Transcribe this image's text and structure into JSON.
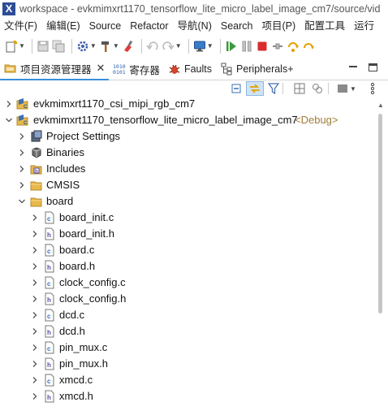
{
  "window": {
    "title": "workspace - evkmimxrt1170_tensorflow_lite_micro_label_image_cm7/source/vid"
  },
  "menu": {
    "items": [
      {
        "label": "文件(F)"
      },
      {
        "label": "编辑(E)"
      },
      {
        "label": "Source"
      },
      {
        "label": "Refactor"
      },
      {
        "label": "导航(N)"
      },
      {
        "label": "Search"
      },
      {
        "label": "项目(P)"
      },
      {
        "label": "配置工具"
      },
      {
        "label": "运行"
      }
    ]
  },
  "tabs": [
    {
      "label": "项目资源管理器",
      "icon": "project-explorer-icon",
      "active": true
    },
    {
      "label": "寄存器",
      "icon": "registers-icon"
    },
    {
      "label": "Faults",
      "icon": "faults-bug-icon"
    },
    {
      "label": "Peripherals+",
      "icon": "peripherals-icon"
    }
  ],
  "tab_close_glyph": "✕",
  "tree": {
    "decoration": "<Debug>",
    "items": [
      {
        "label": "evkmimxrt1170_csi_mipi_rgb_cm7",
        "icon": "project",
        "expanded": false
      },
      {
        "label": "evkmimxrt1170_tensorflow_lite_micro_label_image_cm7",
        "icon": "project",
        "expanded": true,
        "decorated": true
      },
      {
        "label": "Project Settings",
        "icon": "settings",
        "expanded": false
      },
      {
        "label": "Binaries",
        "icon": "binaries",
        "expanded": false
      },
      {
        "label": "Includes",
        "icon": "includes",
        "expanded": false
      },
      {
        "label": "CMSIS",
        "icon": "folder",
        "expanded": false
      },
      {
        "label": "board",
        "icon": "folder",
        "expanded": true
      },
      {
        "label": "board_init.c",
        "icon": "c-file",
        "expanded": false
      },
      {
        "label": "board_init.h",
        "icon": "h-file",
        "expanded": false
      },
      {
        "label": "board.c",
        "icon": "c-file",
        "expanded": false
      },
      {
        "label": "board.h",
        "icon": "h-file",
        "expanded": false
      },
      {
        "label": "clock_config.c",
        "icon": "c-file",
        "expanded": false
      },
      {
        "label": "clock_config.h",
        "icon": "h-file",
        "expanded": false
      },
      {
        "label": "dcd.c",
        "icon": "c-file",
        "expanded": false
      },
      {
        "label": "dcd.h",
        "icon": "h-file",
        "expanded": false
      },
      {
        "label": "pin_mux.c",
        "icon": "c-file",
        "expanded": false
      },
      {
        "label": "pin_mux.h",
        "icon": "h-file",
        "expanded": false
      },
      {
        "label": "xmcd.c",
        "icon": "c-file",
        "expanded": false
      },
      {
        "label": "xmcd.h",
        "icon": "h-file",
        "expanded": false
      }
    ]
  },
  "colors": {
    "accent": "#3a8edb",
    "decoration": "#a07d3a",
    "folder": "#e8b84a",
    "c_file": "#3c6fb0",
    "h_file": "#5a4a9a"
  }
}
